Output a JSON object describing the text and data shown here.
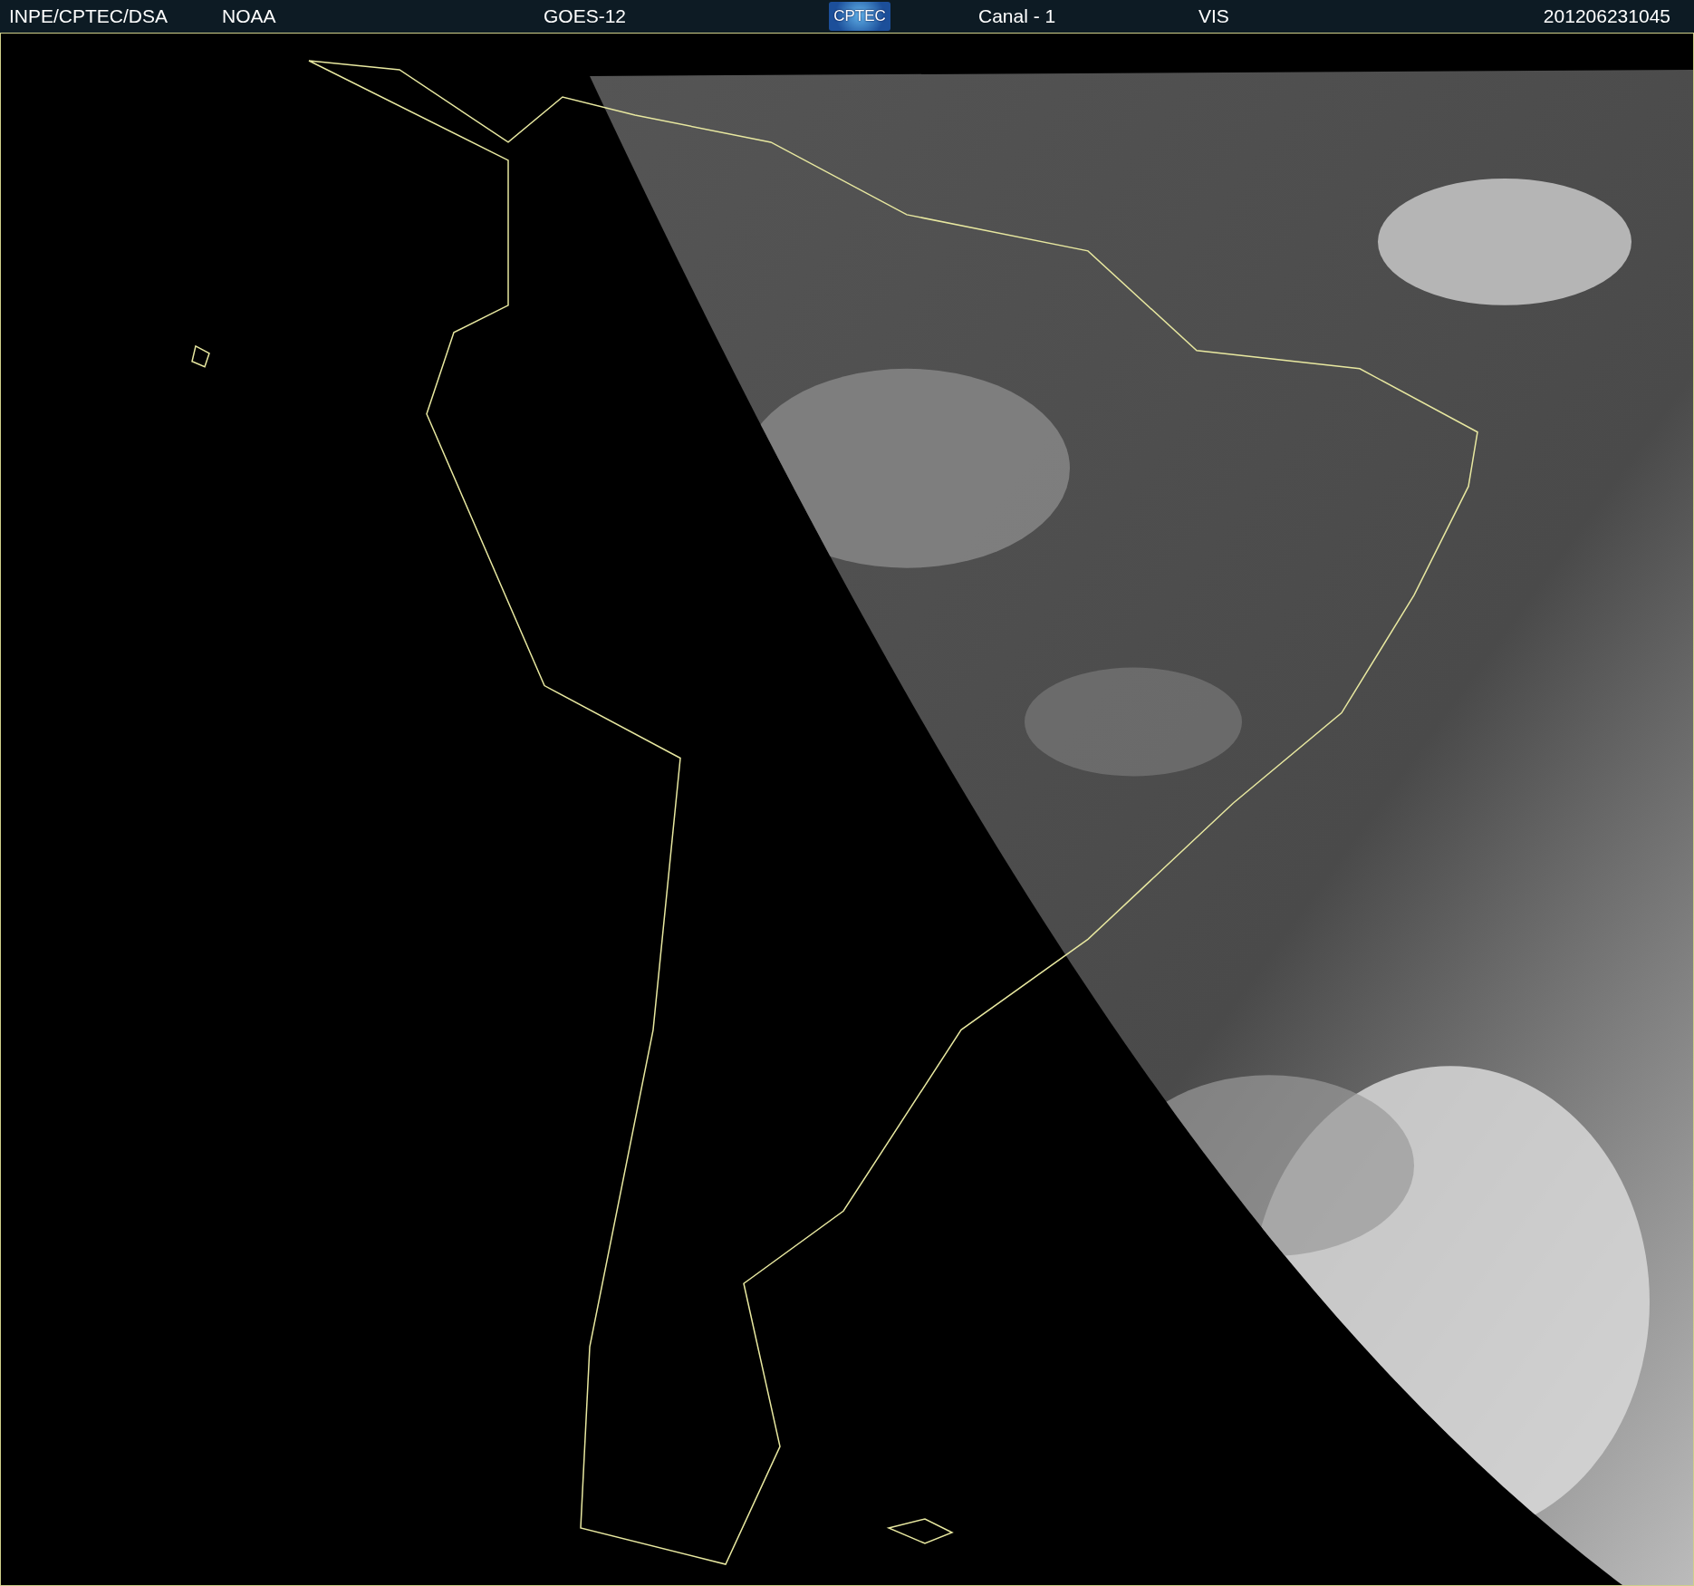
{
  "header": {
    "source": "INPE/CPTEC/DSA",
    "agency": "NOAA",
    "satellite": "GOES-12",
    "logo": "CPTEC",
    "channel": "Canal - 1",
    "band": "VIS",
    "timestamp": "201206231045"
  }
}
